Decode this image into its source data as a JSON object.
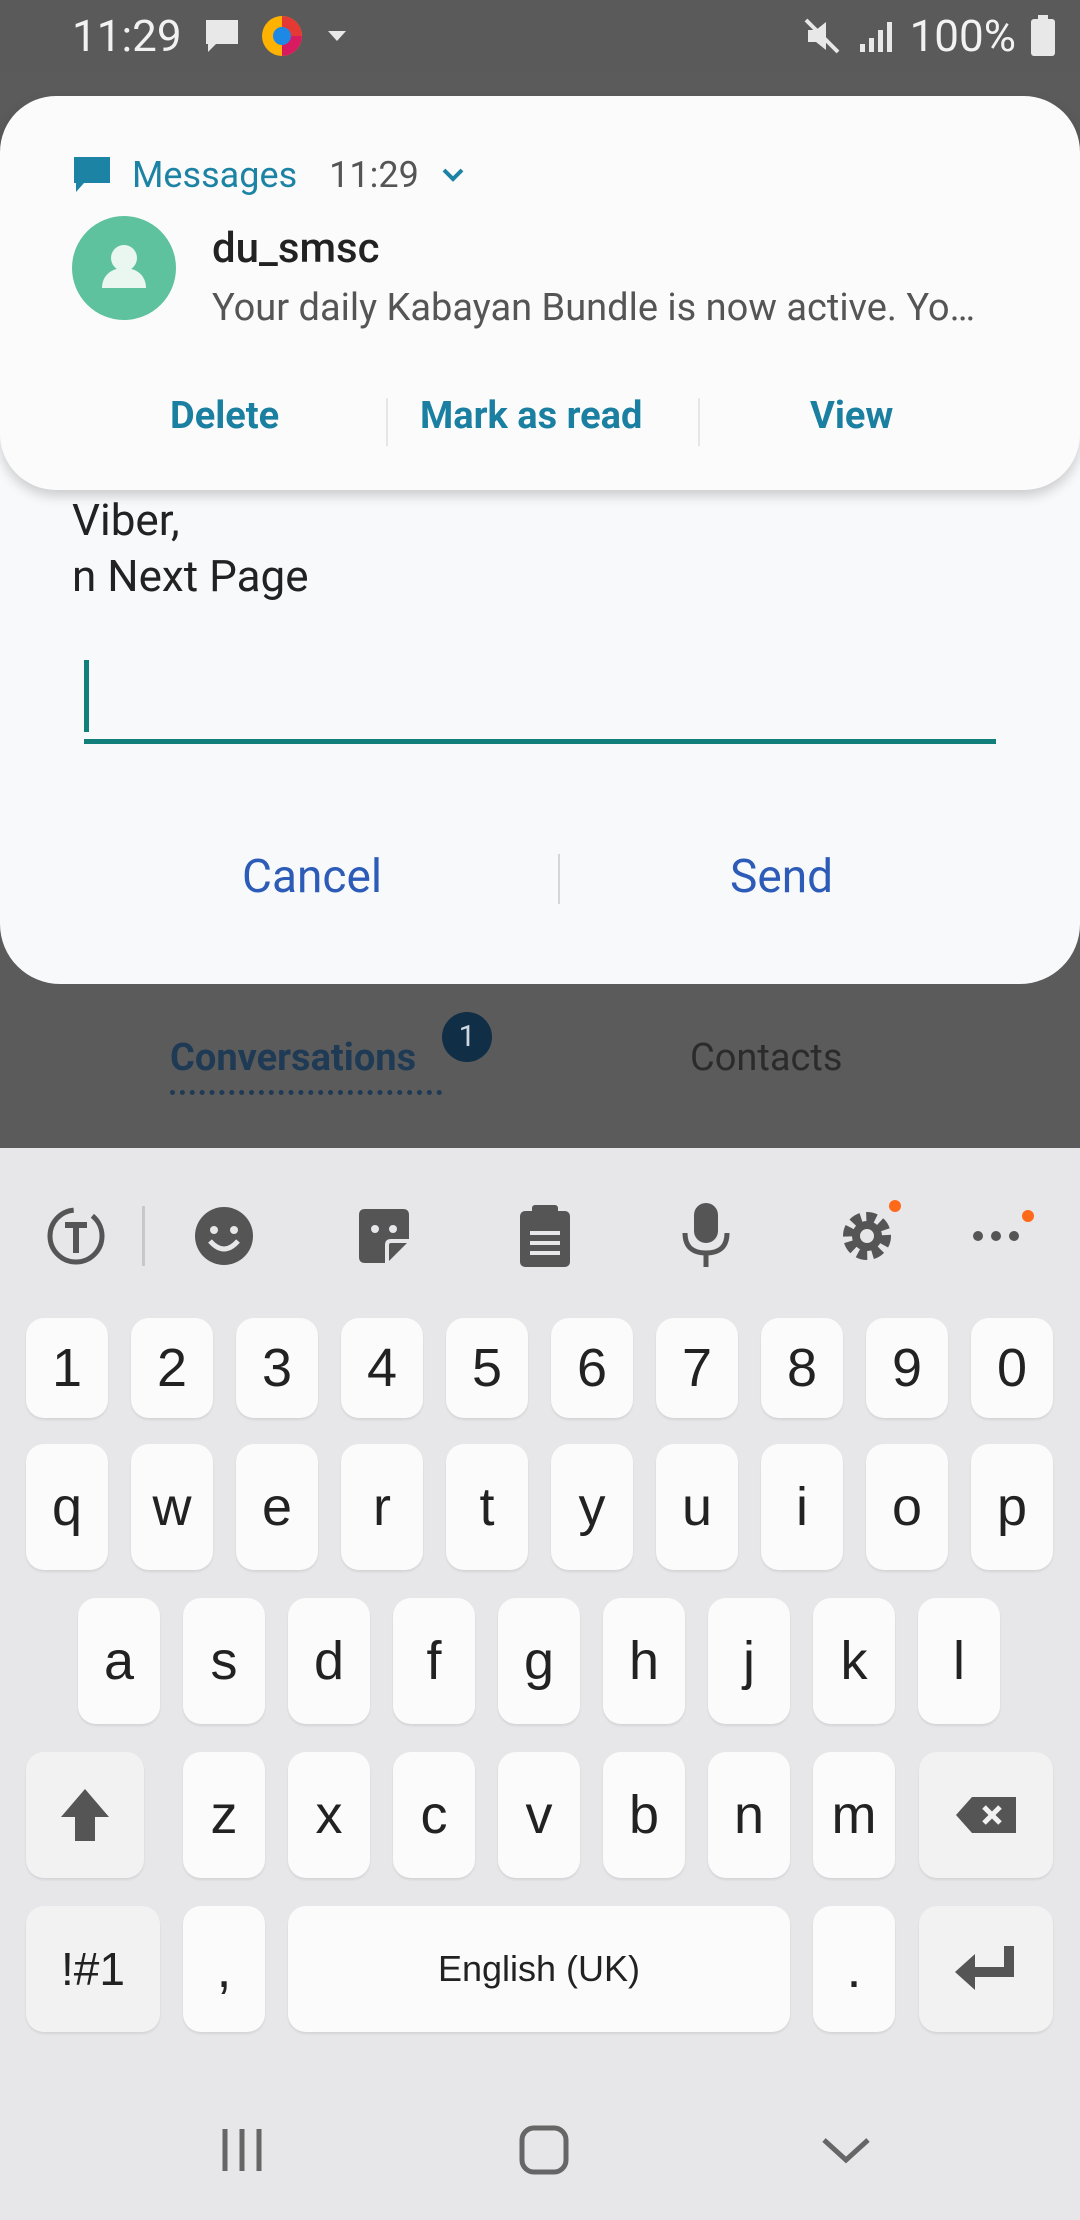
{
  "status_bar": {
    "time": "11:29",
    "battery": "100%"
  },
  "notification": {
    "app_name": "Messages",
    "time": "11:29",
    "sender": "du_smsc",
    "body": "Your daily Kabayan Bundle is now active. Yo…",
    "actions": [
      "Delete",
      "Mark as read",
      "View"
    ]
  },
  "dialog": {
    "text_line1": "Viber,",
    "text_line2": "n Next Page",
    "input_value": "",
    "cancel_label": "Cancel",
    "send_label": "Send"
  },
  "tabs": {
    "conversations": "Conversations",
    "conversations_badge": "1",
    "contacts": "Contacts"
  },
  "keyboard": {
    "row_numbers": [
      "1",
      "2",
      "3",
      "4",
      "5",
      "6",
      "7",
      "8",
      "9",
      "0"
    ],
    "row1": [
      "q",
      "w",
      "e",
      "r",
      "t",
      "y",
      "u",
      "i",
      "o",
      "p"
    ],
    "row2": [
      "a",
      "s",
      "d",
      "f",
      "g",
      "h",
      "j",
      "k",
      "l"
    ],
    "row3": [
      "z",
      "x",
      "c",
      "v",
      "b",
      "n",
      "m"
    ],
    "symbols_label": "!#1",
    "comma": ",",
    "space_label": "English (UK)",
    "period": "."
  },
  "colors": {
    "accent": "#137f7a",
    "dialog_button": "#2d5bb8",
    "notif_accent": "#1d83a4"
  }
}
